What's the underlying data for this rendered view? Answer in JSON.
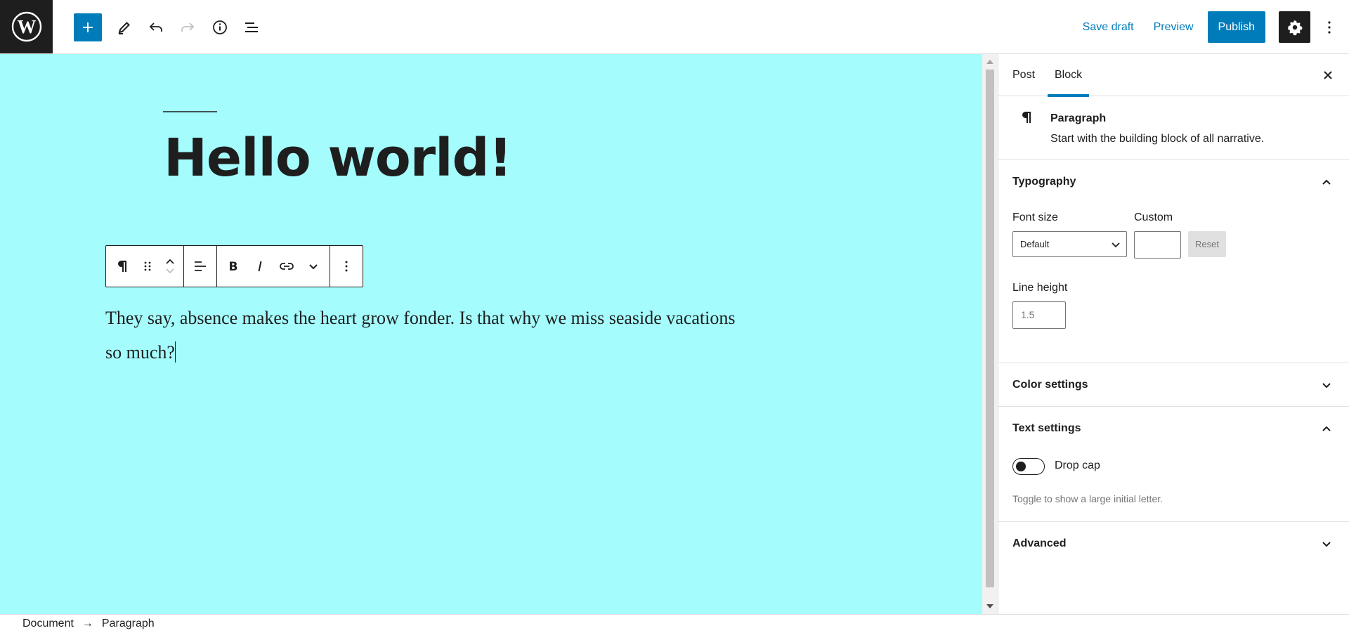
{
  "toolbar": {
    "save_draft": "Save draft",
    "preview": "Preview",
    "publish": "Publish"
  },
  "editor": {
    "title": "Hello world!",
    "paragraph": "They say, absence makes the heart grow fonder. Is that why we miss seaside vacations so much?",
    "canvas_color": "#a4fcfd"
  },
  "sidebar": {
    "tabs": [
      {
        "label": "Post",
        "active": false
      },
      {
        "label": "Block",
        "active": true
      }
    ],
    "block_card": {
      "title": "Paragraph",
      "description": "Start with the building block of all narrative."
    },
    "typography": {
      "heading": "Typography",
      "font_size_label": "Font size",
      "font_size_value": "Default",
      "custom_label": "Custom",
      "reset_label": "Reset",
      "line_height_label": "Line height",
      "line_height_placeholder": "1.5"
    },
    "color_settings": {
      "heading": "Color settings"
    },
    "text_settings": {
      "heading": "Text settings",
      "drop_cap_label": "Drop cap",
      "drop_cap_help": "Toggle to show a large initial letter."
    },
    "advanced": {
      "heading": "Advanced"
    }
  },
  "breadcrumb": {
    "items": [
      "Document",
      "Paragraph"
    ],
    "separator": "→"
  },
  "colors": {
    "accent": "#007cba",
    "dark": "#1e1e1e"
  }
}
